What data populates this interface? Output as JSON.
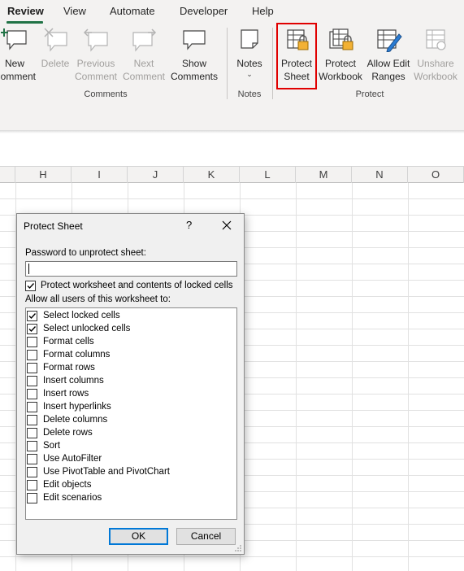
{
  "ribbon": {
    "tabs": [
      {
        "label": "Review",
        "active": true
      },
      {
        "label": "View",
        "active": false
      },
      {
        "label": "Automate",
        "active": false
      },
      {
        "label": "Developer",
        "active": false
      },
      {
        "label": "Help",
        "active": false
      }
    ],
    "comments_group": {
      "label": "Comments",
      "buttons": [
        {
          "label": "New\nComment",
          "icon": "new-comment-icon",
          "enabled": true
        },
        {
          "label": "Delete",
          "icon": "delete-comment-icon",
          "enabled": false
        },
        {
          "label": "Previous\nComment",
          "icon": "previous-comment-icon",
          "enabled": false
        },
        {
          "label": "Next\nComment",
          "icon": "next-comment-icon",
          "enabled": false
        },
        {
          "label": "Show\nComments",
          "icon": "show-comments-icon",
          "enabled": true
        }
      ]
    },
    "notes_group": {
      "label": "Notes",
      "buttons": [
        {
          "label": "Notes",
          "icon": "notes-icon",
          "dropdown": true,
          "enabled": true
        }
      ]
    },
    "protect_group": {
      "label": "Protect",
      "buttons": [
        {
          "label": "Protect\nSheet",
          "icon": "protect-sheet-icon",
          "enabled": true,
          "highlighted": true
        },
        {
          "label": "Protect\nWorkbook",
          "icon": "protect-workbook-icon",
          "enabled": true
        },
        {
          "label": "Allow Edit\nRanges",
          "icon": "allow-edit-ranges-icon",
          "enabled": true
        },
        {
          "label": "Unshare\nWorkbook",
          "icon": "unshare-workbook-icon",
          "enabled": false
        }
      ]
    },
    "accent_color": "#217346",
    "highlight_color": "#e00000"
  },
  "grid": {
    "columns": [
      "H",
      "I",
      "J",
      "K",
      "L",
      "M",
      "N",
      "O"
    ]
  },
  "dialog": {
    "title": "Protect Sheet",
    "help": "?",
    "password_label": "Password to unprotect sheet:",
    "password_value": "",
    "protect_contents_label": "Protect worksheet and contents of locked cells",
    "protect_contents_checked": true,
    "allow_label": "Allow all users of this worksheet to:",
    "permissions": [
      {
        "label": "Select locked cells",
        "checked": true
      },
      {
        "label": "Select unlocked cells",
        "checked": true
      },
      {
        "label": "Format cells",
        "checked": false
      },
      {
        "label": "Format columns",
        "checked": false
      },
      {
        "label": "Format rows",
        "checked": false
      },
      {
        "label": "Insert columns",
        "checked": false
      },
      {
        "label": "Insert rows",
        "checked": false
      },
      {
        "label": "Insert hyperlinks",
        "checked": false
      },
      {
        "label": "Delete columns",
        "checked": false
      },
      {
        "label": "Delete rows",
        "checked": false
      },
      {
        "label": "Sort",
        "checked": false
      },
      {
        "label": "Use AutoFilter",
        "checked": false
      },
      {
        "label": "Use PivotTable and PivotChart",
        "checked": false
      },
      {
        "label": "Edit objects",
        "checked": false
      },
      {
        "label": "Edit scenarios",
        "checked": false
      }
    ],
    "ok_label": "OK",
    "cancel_label": "Cancel"
  }
}
